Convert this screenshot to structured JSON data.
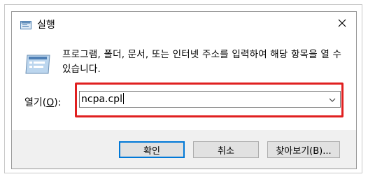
{
  "window": {
    "title": "실행",
    "title_icon": "run-icon",
    "close_icon": "close-icon"
  },
  "dialog": {
    "description": "프로그램, 폴더, 문서, 또는 인터넷 주소를 입력하여 해당 항목을 열 수 있습니다.",
    "app_icon": "run-app-icon"
  },
  "open_field": {
    "label_prefix": "열기(",
    "label_hotkey": "O",
    "label_suffix": "):",
    "value": "ncpa.cpl",
    "dropdown_icon": "chevron-down-icon",
    "highlight_color": "#e02020"
  },
  "buttons": {
    "ok": "확인",
    "cancel": "취소",
    "browse": "찾아보기(B)..."
  },
  "colors": {
    "accent": "#0078d7",
    "footer_bg": "#f0f0f0"
  }
}
